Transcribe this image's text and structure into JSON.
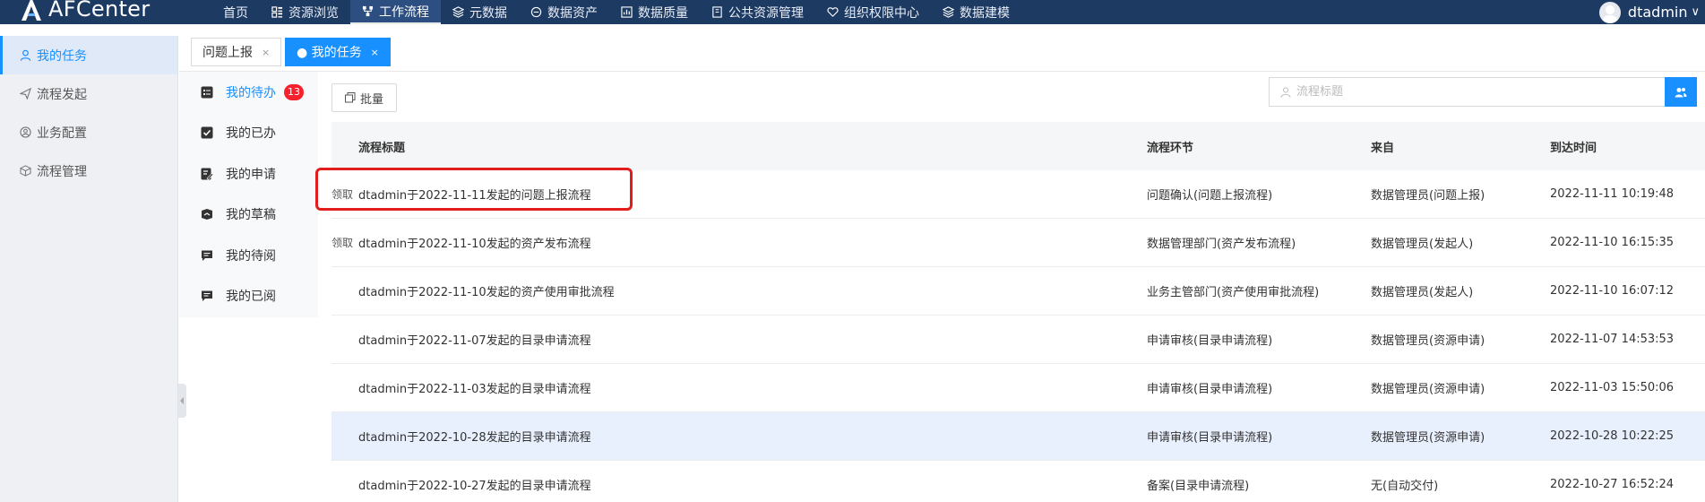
{
  "app": {
    "name": "AFCenter"
  },
  "nav": [
    {
      "label": "首页",
      "icon": ""
    },
    {
      "label": "资源浏览",
      "icon": "grid-icon"
    },
    {
      "label": "工作流程",
      "icon": "workflow-icon",
      "active": true
    },
    {
      "label": "元数据",
      "icon": "layers-icon"
    },
    {
      "label": "数据资产",
      "icon": "asset-icon"
    },
    {
      "label": "数据质量",
      "icon": "chart-icon"
    },
    {
      "label": "公共资源管理",
      "icon": "book-icon"
    },
    {
      "label": "组织权限中心",
      "icon": "heart-shield-icon"
    },
    {
      "label": "数据建模",
      "icon": "layers-icon"
    }
  ],
  "user": {
    "name": "dtadmin",
    "caret": "∨"
  },
  "sidebar": {
    "items": [
      {
        "label": "我的任务",
        "icon": "user-icon",
        "active": true
      },
      {
        "label": "流程发起",
        "icon": "send-icon"
      },
      {
        "label": "业务配置",
        "icon": "user-circle-icon"
      },
      {
        "label": "流程管理",
        "icon": "cube-icon"
      }
    ]
  },
  "tabs": [
    {
      "label": "问题上报",
      "close": "×"
    },
    {
      "label": "● 我的任务",
      "close": "×",
      "active": true
    }
  ],
  "taskmenu": {
    "items": [
      {
        "label": "我的待办",
        "badge": "13",
        "active": true
      },
      {
        "label": "我的已办"
      },
      {
        "label": "我的申请"
      },
      {
        "label": "我的草稿"
      },
      {
        "label": "我的待阅"
      },
      {
        "label": "我的已阅"
      }
    ]
  },
  "toolbar": {
    "batch_label": "批量"
  },
  "search": {
    "placeholder": "流程标题",
    "value": ""
  },
  "table": {
    "columns": [
      "流程标题",
      "流程环节",
      "来自",
      "到达时间"
    ],
    "rows": [
      {
        "action": "领取",
        "title": "dtadmin于2022-11-11发起的问题上报流程",
        "step": "问题确认(问题上报流程)",
        "from": "数据管理员(问题上报)",
        "time": "2022-11-11 10:19:48"
      },
      {
        "action": "领取",
        "title": "dtadmin于2022-11-10发起的资产发布流程",
        "step": "数据管理部门(资产发布流程)",
        "from": "数据管理员(发起人)",
        "time": "2022-11-10 16:15:35"
      },
      {
        "action": "",
        "title": "dtadmin于2022-11-10发起的资产使用审批流程",
        "step": "业务主管部门(资产使用审批流程)",
        "from": "数据管理员(发起人)",
        "time": "2022-11-10 16:07:12"
      },
      {
        "action": "",
        "title": "dtadmin于2022-11-07发起的目录申请流程",
        "step": "申请审核(目录申请流程)",
        "from": "数据管理员(资源申请)",
        "time": "2022-11-07 14:53:53"
      },
      {
        "action": "",
        "title": "dtadmin于2022-11-03发起的目录申请流程",
        "step": "申请审核(目录申请流程)",
        "from": "数据管理员(资源申请)",
        "time": "2022-11-03 15:50:06"
      },
      {
        "action": "",
        "title": "dtadmin于2022-10-28发起的目录申请流程",
        "step": "申请审核(目录申请流程)",
        "from": "数据管理员(资源申请)",
        "time": "2022-10-28 10:22:25",
        "highlight": true
      },
      {
        "action": "",
        "title": "dtadmin于2022-10-27发起的目录申请流程",
        "step": "备案(目录申请流程)",
        "from": "无(自动交付)",
        "time": "2022-10-27 16:52:24"
      }
    ]
  },
  "colors": {
    "topbar": "#1d3a63",
    "accent": "#1890ff",
    "highlight_box": "#e21d1d",
    "badge": "#f5222d"
  }
}
